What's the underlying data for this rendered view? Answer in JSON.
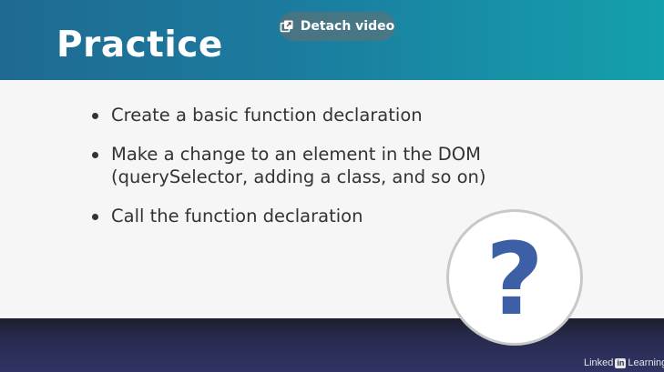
{
  "slide": {
    "title": "Practice",
    "bullets": [
      "Create a basic function declaration",
      "Make a change to an element in the DOM (querySelector, adding a class, and so on)",
      "Call the function declaration"
    ],
    "question_mark": "?"
  },
  "overlay": {
    "detach_label": "Detach video",
    "detach_icon": "detach-window-icon"
  },
  "watermark": {
    "brand_prefix": "Linked",
    "brand_box": "in",
    "brand_suffix": "Learning"
  },
  "colors": {
    "header_start": "#1f6a92",
    "header_end": "#14a0ac",
    "question_mark": "#3d5fa6",
    "bottom_band": "#272a4d"
  }
}
